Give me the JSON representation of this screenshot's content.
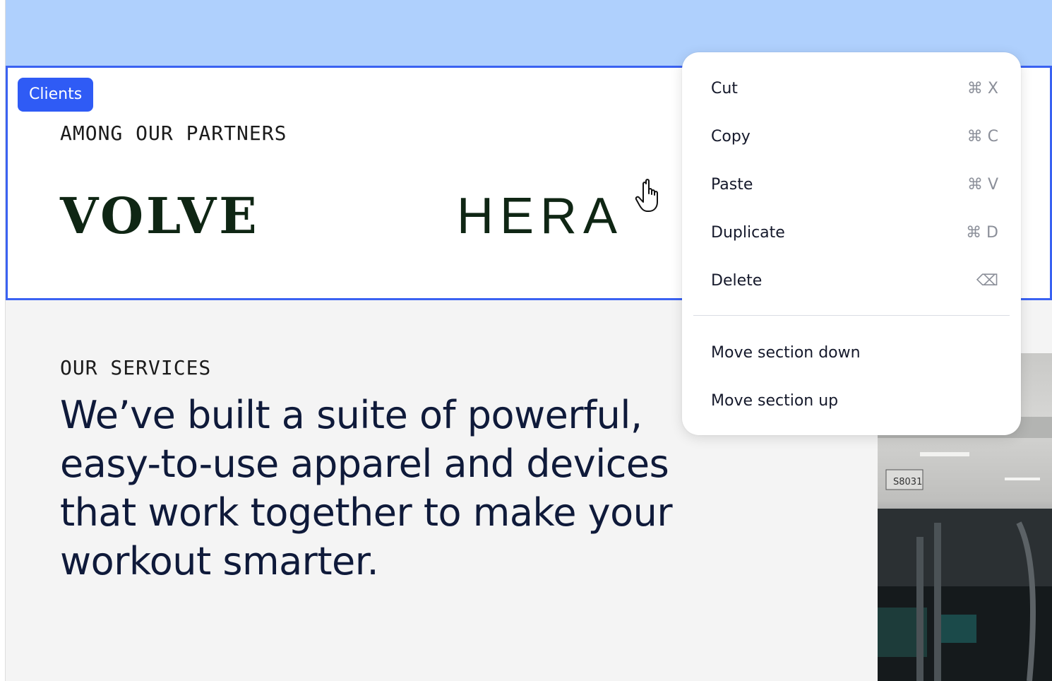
{
  "section": {
    "tag": "Clients",
    "partners_heading": "AMONG OUR PARTNERS",
    "logos": [
      "VOLVE",
      "HERA"
    ]
  },
  "services": {
    "heading": "OUR SERVICES",
    "body": "We’ve built a suite of powerful, easy-to-use apparel and devices that work together to make your workout smarter."
  },
  "context_menu": {
    "items": [
      {
        "label": "Cut",
        "shortcut": "⌘ X"
      },
      {
        "label": "Copy",
        "shortcut": "⌘ C"
      },
      {
        "label": "Paste",
        "shortcut": "⌘ V"
      },
      {
        "label": "Duplicate",
        "shortcut": "⌘ D"
      },
      {
        "label": "Delete",
        "shortcut": "⌫"
      },
      {
        "label": "Move section down",
        "shortcut": ""
      },
      {
        "label": "Move section up",
        "shortcut": ""
      }
    ]
  },
  "photo": {
    "sign_text": "S8031"
  },
  "colors": {
    "accent": "#2f5bf5",
    "section_border": "#3a62f2",
    "top_band": "#afd0fd",
    "logo": "#0f2614"
  },
  "icons": {
    "cursor": "hand-pointer-icon",
    "delete": "backspace-icon"
  }
}
